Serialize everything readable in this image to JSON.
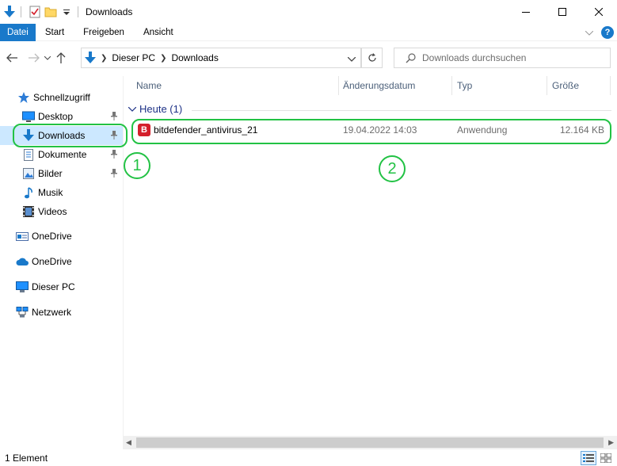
{
  "window": {
    "title": "Downloads",
    "controls": {
      "minimize": "minimize-icon",
      "maximize": "maximize-icon",
      "close": "close-icon"
    }
  },
  "ribbon": {
    "tabs": [
      "Datei",
      "Start",
      "Freigeben",
      "Ansicht"
    ],
    "help": "?"
  },
  "address": {
    "crumbs": [
      "Dieser PC",
      "Downloads"
    ],
    "search_placeholder": "Downloads durchsuchen"
  },
  "sidebar": {
    "items": [
      {
        "label": "Schnellzugriff",
        "icon": "star-icon"
      },
      {
        "label": "Desktop",
        "icon": "desktop-icon",
        "pinned": true
      },
      {
        "label": "Downloads",
        "icon": "download-icon",
        "pinned": true,
        "selected": true
      },
      {
        "label": "Dokumente",
        "icon": "document-icon",
        "pinned": true
      },
      {
        "label": "Bilder",
        "icon": "pictures-icon",
        "pinned": true
      },
      {
        "label": "Musik",
        "icon": "music-icon"
      },
      {
        "label": "Videos",
        "icon": "video-icon"
      },
      {
        "label": "OneDrive",
        "icon": "onedrive-folder-icon"
      },
      {
        "label": "OneDrive",
        "icon": "onedrive-cloud-icon"
      },
      {
        "label": "Dieser PC",
        "icon": "computer-icon"
      },
      {
        "label": "Netzwerk",
        "icon": "network-icon"
      }
    ]
  },
  "columns": [
    "Name",
    "Änderungsdatum",
    "Typ",
    "Größe"
  ],
  "group": {
    "label": "Heute (1)"
  },
  "files": [
    {
      "name": "bitdefender_antivirus_21",
      "date": "19.04.2022 14:03",
      "type": "Anwendung",
      "size": "12.164 KB",
      "icon": "bitdefender-icon",
      "icon_letter": "B"
    }
  ],
  "annotations": [
    "1",
    "2"
  ],
  "status": {
    "text": "1 Element"
  },
  "colors": {
    "accent": "#1979ca",
    "annotation": "#22c244",
    "selected": "#cce8ff",
    "group": "#1e3287"
  }
}
